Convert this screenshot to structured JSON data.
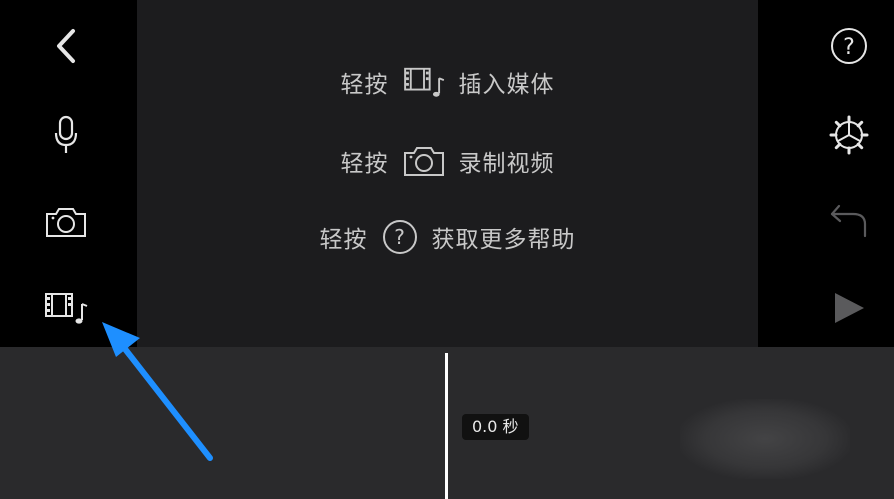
{
  "left_toolbar": {
    "back_icon": "chevron-left-icon",
    "mic_icon": "microphone-icon",
    "camera_icon": "camera-icon",
    "media_icon": "media-film-music-icon"
  },
  "right_toolbar": {
    "help_icon": "question-circle-icon",
    "settings_icon": "gear-icon",
    "undo_icon": "undo-icon",
    "play_icon": "play-icon"
  },
  "hints": [
    {
      "prefix": "轻按",
      "icon": "media-film-music-icon",
      "text": "插入媒体"
    },
    {
      "prefix": "轻按",
      "icon": "camera-icon",
      "text": "录制视频"
    },
    {
      "prefix": "轻按",
      "icon": "question-circle-icon",
      "text": "获取更多帮助"
    }
  ],
  "timeline": {
    "time_label": "0.0 秒"
  },
  "annotation": {
    "arrow_color": "#1e8fff"
  }
}
